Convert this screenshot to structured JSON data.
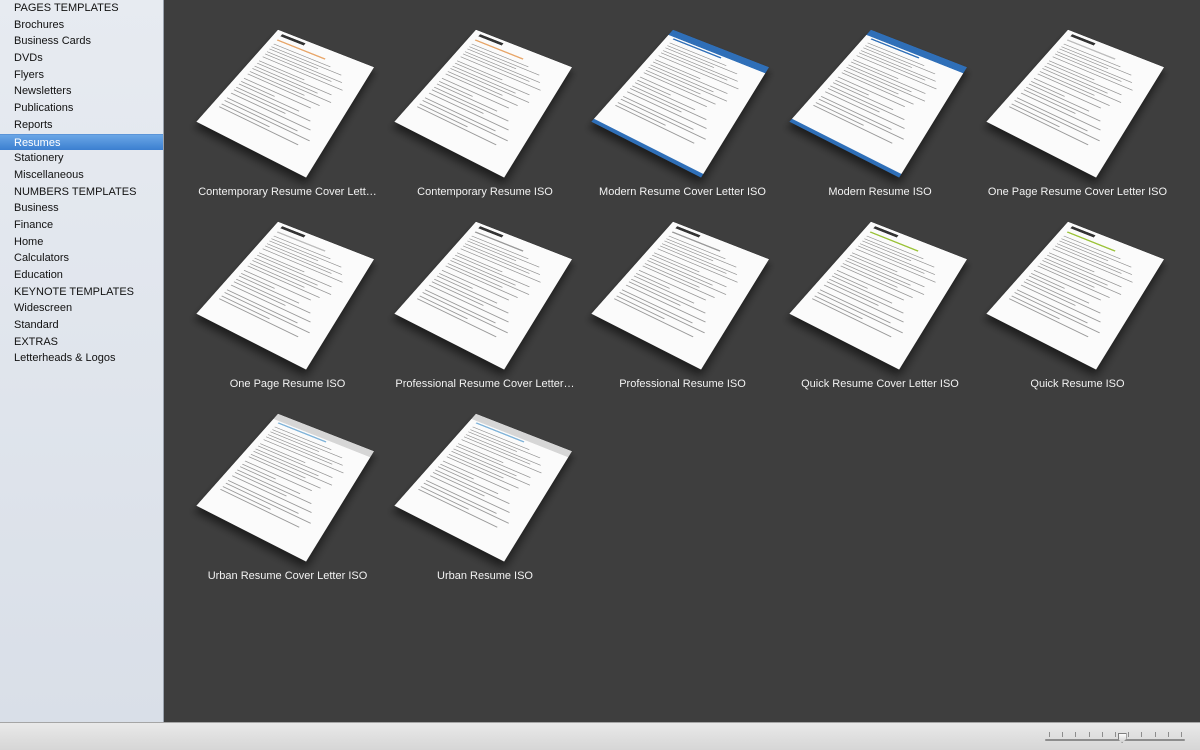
{
  "sidebar": {
    "items": [
      {
        "label": "PAGES TEMPLATES",
        "heading": true
      },
      {
        "label": "Brochures"
      },
      {
        "label": "Business Cards"
      },
      {
        "label": "DVDs"
      },
      {
        "label": "Flyers"
      },
      {
        "label": "Newsletters"
      },
      {
        "label": "Publications"
      },
      {
        "label": "Reports"
      },
      {
        "label": "Resumes",
        "selected": true
      },
      {
        "label": "Stationery"
      },
      {
        "label": "Miscellaneous"
      },
      {
        "label": "NUMBERS TEMPLATES",
        "heading": true
      },
      {
        "label": "Business"
      },
      {
        "label": "Finance"
      },
      {
        "label": "Home"
      },
      {
        "label": "Calculators"
      },
      {
        "label": "Education"
      },
      {
        "label": "KEYNOTE TEMPLATES",
        "heading": true
      },
      {
        "label": "Widescreen"
      },
      {
        "label": "Standard"
      },
      {
        "label": "EXTRAS",
        "heading": true
      },
      {
        "label": "Letterheads & Logos"
      }
    ]
  },
  "templates": [
    {
      "label": "Contemporary Resume Cover Lett…",
      "style": "plain",
      "accent": "#e8a76b"
    },
    {
      "label": "Contemporary Resume ISO",
      "style": "plain",
      "accent": "#e8a76b"
    },
    {
      "label": "Modern Resume Cover Letter ISO",
      "style": "blue",
      "accent": "#2f6fb8"
    },
    {
      "label": "Modern Resume ISO",
      "style": "blue",
      "accent": "#2f6fb8"
    },
    {
      "label": "One Page Resume Cover Letter ISO",
      "style": "plain",
      "accent": "#bdbdbd"
    },
    {
      "label": "One Page Resume ISO",
      "style": "plain",
      "accent": "#bdbdbd"
    },
    {
      "label": "Professional Resume Cover Letter…",
      "style": "plain",
      "accent": "#9a9a9a"
    },
    {
      "label": "Professional Resume ISO",
      "style": "plain",
      "accent": "#9a9a9a"
    },
    {
      "label": "Quick Resume Cover Letter ISO",
      "style": "plain",
      "accent": "#9cc33a"
    },
    {
      "label": "Quick Resume ISO",
      "style": "plain",
      "accent": "#9cc33a"
    },
    {
      "label": "Urban Resume Cover Letter ISO",
      "style": "grey",
      "accent": "#7fb3d9"
    },
    {
      "label": "Urban Resume ISO",
      "style": "grey",
      "accent": "#7fb3d9"
    }
  ],
  "zoom": {
    "level_fraction": 0.55,
    "ticks": 11
  }
}
